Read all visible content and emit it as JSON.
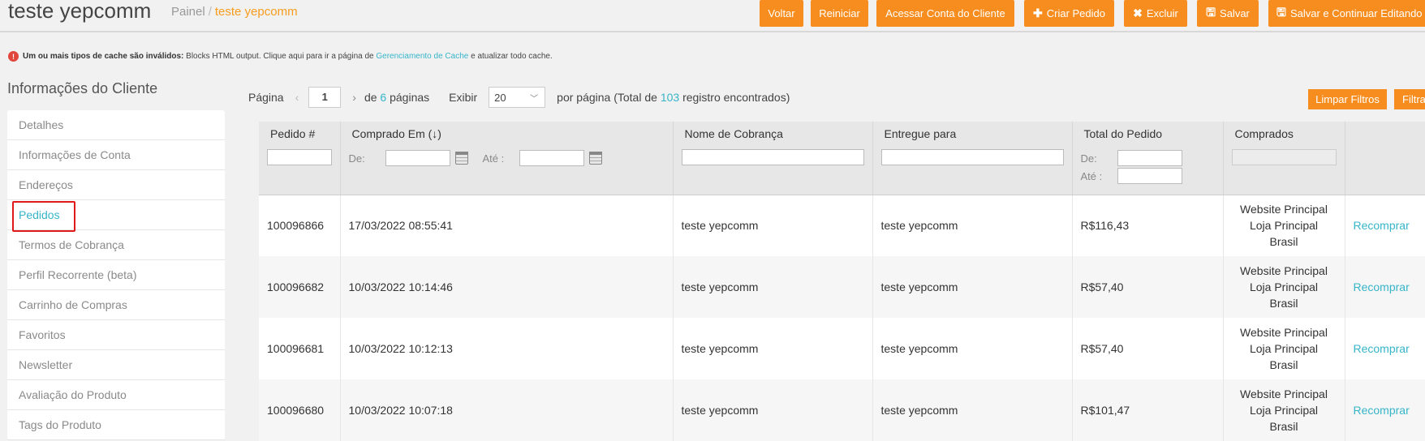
{
  "header": {
    "title": "teste yepcomm",
    "breadcrumb_home": "Painel",
    "breadcrumb_sep": "/",
    "breadcrumb_current": "teste yepcomm"
  },
  "toolbar": {
    "back": "Voltar",
    "reset": "Reiniciar",
    "login_as": "Acessar Conta do Cliente",
    "create_order": "Criar Pedido",
    "delete": "Excluir",
    "save": "Salvar",
    "save_continue": "Salvar e Continuar Editando"
  },
  "cache_message": {
    "bold": "Um ou mais tipos de cache são inválidos:",
    "text": " Blocks HTML output. Clique aqui para ir a página de ",
    "link": "Gerenciamento de Cache",
    "suffix": " e atualizar todo cache."
  },
  "sidebar": {
    "title": "Informações do Cliente",
    "items": [
      {
        "label": "Detalhes"
      },
      {
        "label": "Informações de Conta"
      },
      {
        "label": "Endereços"
      },
      {
        "label": "Pedidos",
        "active": true
      },
      {
        "label": "Termos de Cobrança"
      },
      {
        "label": "Perfil Recorrente (beta)"
      },
      {
        "label": "Carrinho de Compras"
      },
      {
        "label": "Favoritos"
      },
      {
        "label": "Newsletter"
      },
      {
        "label": "Avaliação do Produto"
      },
      {
        "label": "Tags do Produto"
      }
    ]
  },
  "pager": {
    "page_label": "Página",
    "current_page": "1",
    "of_label": "de",
    "total_pages": "6",
    "pages_label": "páginas",
    "show_label": "Exibir",
    "per_page": "20",
    "per_page_label": "por página (Total de",
    "total_records": "103",
    "records_label": "registro encontrados)"
  },
  "filter_buttons": {
    "clear": "Limpar Filtros",
    "filter": "Filtrar"
  },
  "table": {
    "columns": [
      "Pedido #",
      "Comprado Em (↓)",
      "Nome de Cobrança",
      "Entregue para",
      "Total do Pedido",
      "Comprados",
      ""
    ],
    "filter_from": "De:",
    "filter_to": "Até :",
    "filter_from_total": "De:",
    "filter_to_total": "Até :",
    "rows": [
      {
        "order": "100096866",
        "date": "17/03/2022 08:55:41",
        "billing": "teste yepcomm",
        "shipping": "teste yepcomm",
        "total": "R$116,43",
        "bought": [
          "Website Principal",
          "Loja Principal",
          "Brasil"
        ],
        "action": "Recomprar"
      },
      {
        "order": "100096682",
        "date": "10/03/2022 10:14:46",
        "billing": "teste yepcomm",
        "shipping": "teste yepcomm",
        "total": "R$57,40",
        "bought": [
          "Website Principal",
          "Loja Principal",
          "Brasil"
        ],
        "action": "Recomprar"
      },
      {
        "order": "100096681",
        "date": "10/03/2022 10:12:13",
        "billing": "teste yepcomm",
        "shipping": "teste yepcomm",
        "total": "R$57,40",
        "bought": [
          "Website Principal",
          "Loja Principal",
          "Brasil"
        ],
        "action": "Recomprar"
      },
      {
        "order": "100096680",
        "date": "10/03/2022 10:07:18",
        "billing": "teste yepcomm",
        "shipping": "teste yepcomm",
        "total": "R$101,47",
        "bought": [
          "Website Principal",
          "Loja Principal",
          "Brasil"
        ],
        "action": "Recomprar"
      }
    ]
  }
}
